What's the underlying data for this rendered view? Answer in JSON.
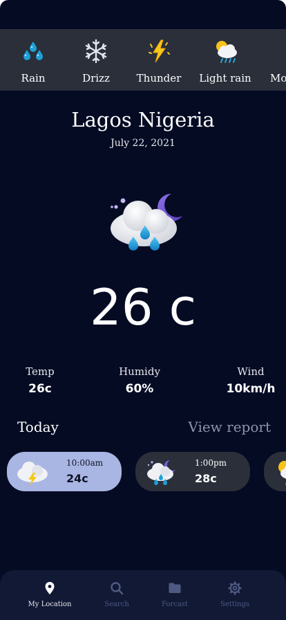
{
  "conditions": [
    {
      "label": "Rain",
      "icon": "rain-drops-icon"
    },
    {
      "label": "Drizz",
      "icon": "snowflake-icon"
    },
    {
      "label": "Thunder",
      "icon": "lightning-icon"
    },
    {
      "label": "Light rain",
      "icon": "sun-cloud-rain-icon"
    },
    {
      "label": "Mo",
      "icon": "partial-item"
    }
  ],
  "location": {
    "city": "Lagos Nigeria",
    "date": "July 22, 2021"
  },
  "current": {
    "temperature": "26 c",
    "icon": "night-cloud-rain-icon"
  },
  "stats": {
    "temp": {
      "label": "Temp",
      "value": "26c"
    },
    "humidity": {
      "label": "Humidy",
      "value": "60%"
    },
    "wind": {
      "label": "Wind",
      "value": "10km/h"
    }
  },
  "today": {
    "title": "Today",
    "link": "View report"
  },
  "hourly": [
    {
      "time": "10:00am",
      "temp": "24c",
      "icon": "thunder-cloud-icon"
    },
    {
      "time": "1:00pm",
      "temp": "28c",
      "icon": "night-cloud-rain-icon"
    }
  ],
  "nav": [
    {
      "label": "My Location",
      "icon": "location-pin-icon"
    },
    {
      "label": "Search",
      "icon": "search-icon"
    },
    {
      "label": "Forcast",
      "icon": "folder-icon"
    },
    {
      "label": "Settings",
      "icon": "gear-icon"
    }
  ],
  "colors": {
    "background": "#040b23",
    "strip": "#2a2f3a",
    "active_card": "#a9b5e2",
    "nav": "#111935",
    "nav_active": "#e8e9ef",
    "nav_inactive": "#4f5a83"
  }
}
